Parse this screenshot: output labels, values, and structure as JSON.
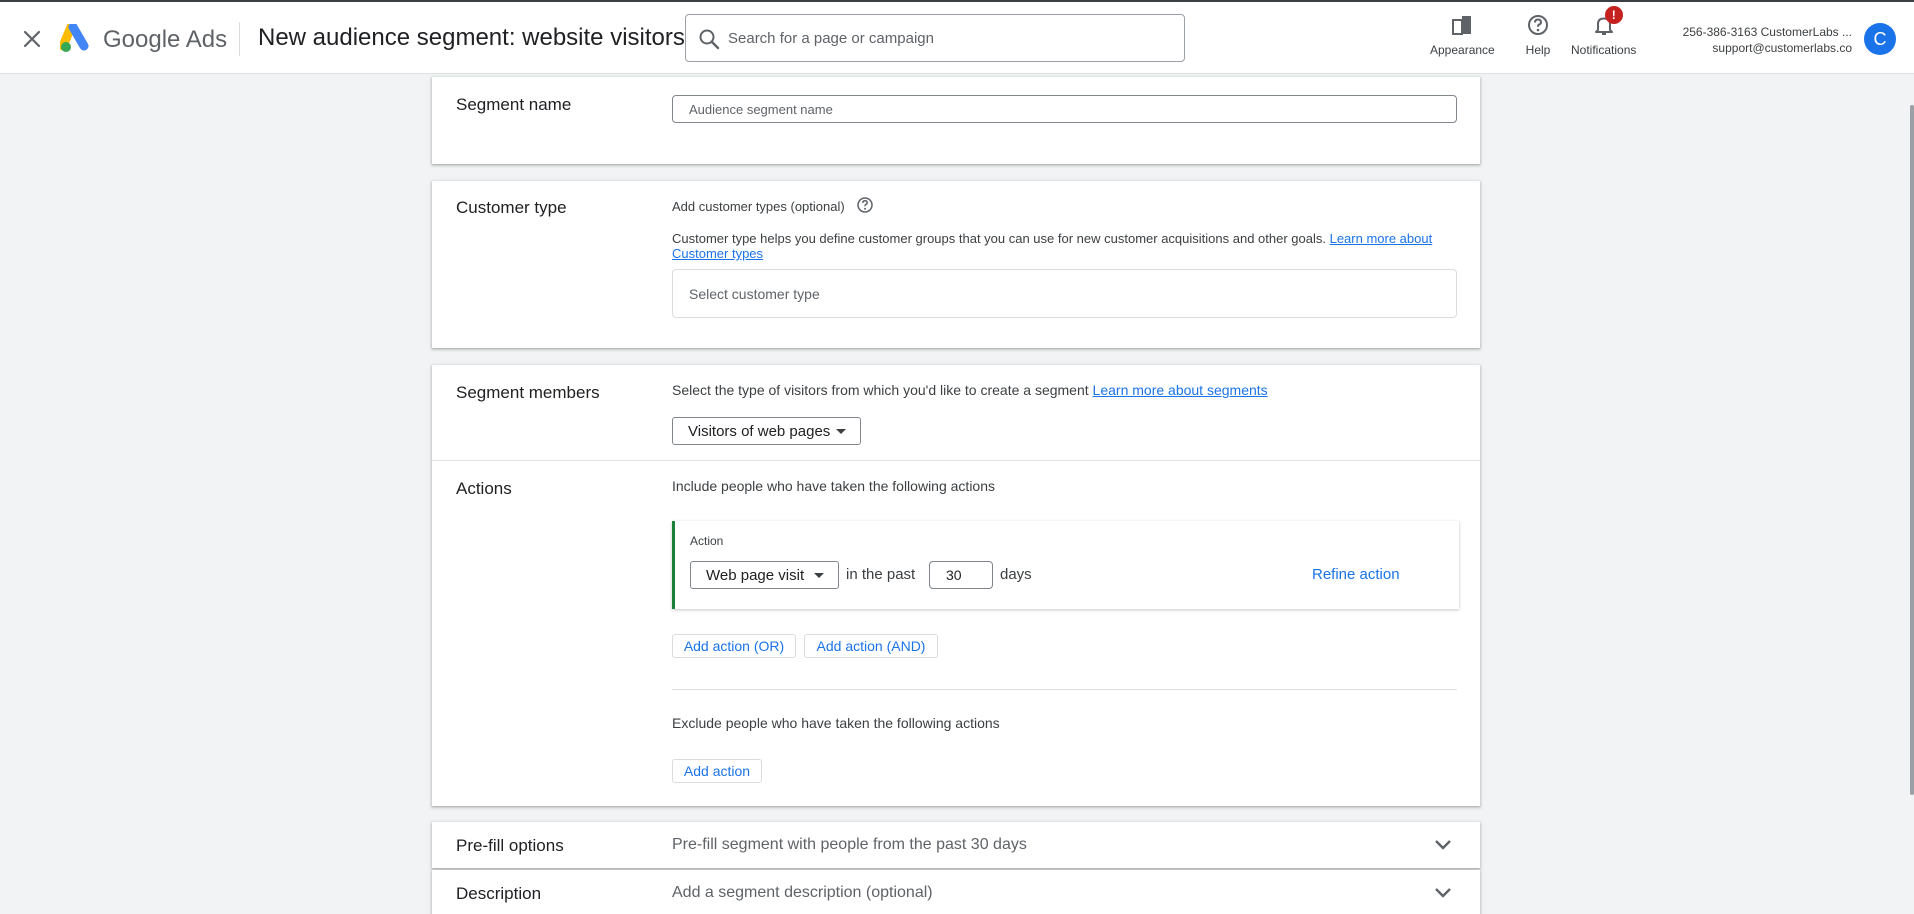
{
  "header": {
    "logo_text": "Google Ads",
    "title": "New audience segment: website visitors",
    "search": {
      "placeholder": "Search for a page or campaign"
    },
    "buttons": {
      "appearance": "Appearance",
      "help": "Help",
      "notifications": "Notifications",
      "notifications_badge": "!"
    },
    "account": {
      "line1": "256-386-3163 CustomerLabs ...",
      "line2": "support@customerlabs.co",
      "avatar_letter": "C"
    }
  },
  "segment_name": {
    "title": "Segment name",
    "placeholder": "Audience segment name"
  },
  "customer_type": {
    "title": "Customer type",
    "add_label": "Add customer types (optional)",
    "description": "Customer type helps you define customer groups that you can use for new customer acquisitions and other goals.",
    "learn_more_line1": "Learn more about",
    "learn_more_line2": "Customer types",
    "select_placeholder": "Select customer type"
  },
  "segment_members": {
    "title": "Segment members",
    "description": "Select the type of visitors from which you'd like to create a segment",
    "learn_more": "Learn more about segments",
    "visitor_type": "Visitors of web pages"
  },
  "actions": {
    "title": "Actions",
    "include_label": "Include people who have taken the following actions",
    "action_label": "Action",
    "action_type": "Web page visit",
    "in_the_past": "in the past",
    "days_value": "30",
    "days_label": "days",
    "refine_action": "Refine action",
    "add_or": "Add action (OR)",
    "add_and": "Add action (AND)",
    "exclude_label": "Exclude people who have taken the following actions",
    "add_action": "Add action"
  },
  "prefill": {
    "title": "Pre-fill options",
    "summary": "Pre-fill segment with people from the past 30 days"
  },
  "description": {
    "title": "Description",
    "summary": "Add a segment description (optional)"
  },
  "colors": {
    "accent": "#1a73e8",
    "action_border": "#188038",
    "badge": "#c5221f"
  },
  "icons": {
    "close": "close-icon",
    "logo": "google-ads-logo",
    "search": "search-icon",
    "appearance": "appearance-icon",
    "help": "help-circle-icon",
    "notifications": "bell-icon",
    "question": "question-circle-icon",
    "caret": "caret-down-icon",
    "chevron": "chevron-down-icon"
  }
}
